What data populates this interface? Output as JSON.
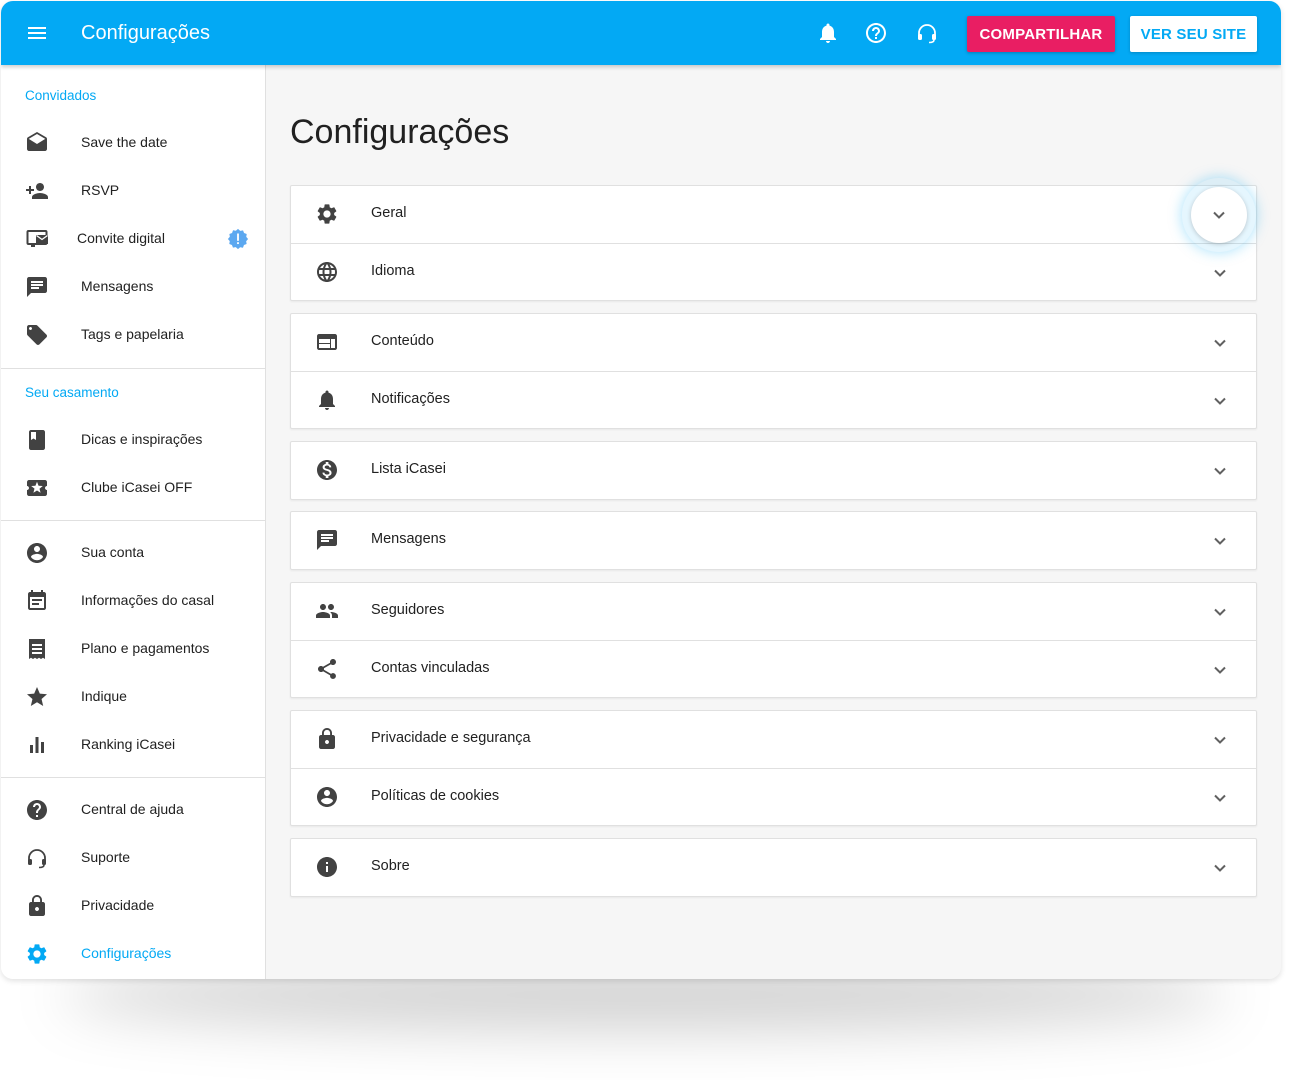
{
  "topbar": {
    "title": "Configurações",
    "share_label": "COMPARTILHAR",
    "site_label": "VER SEU SITE",
    "icons": [
      "menu-icon",
      "bell-icon",
      "help-circle-icon",
      "support-icon"
    ]
  },
  "sidebar": {
    "sections": [
      {
        "label": "Convidados",
        "items": [
          {
            "label": "Save the date",
            "icon": "drafts-icon"
          },
          {
            "label": "RSVP",
            "icon": "person-add-icon"
          },
          {
            "label": "Convite digital",
            "icon": "digital-invite-icon",
            "badge": "info-icon"
          },
          {
            "label": "Mensagens",
            "icon": "message-icon"
          },
          {
            "label": "Tags e papelaria",
            "icon": "tag-icon"
          }
        ]
      },
      {
        "label": "Seu casamento",
        "items": [
          {
            "label": "Dicas e inspirações",
            "icon": "book-icon"
          },
          {
            "label": "Clube iCasei OFF",
            "icon": "ticket-icon"
          }
        ]
      },
      {
        "label": "",
        "items": [
          {
            "label": "Sua conta",
            "icon": "account-circle-icon"
          },
          {
            "label": "Informações do casal",
            "icon": "event-note-icon"
          },
          {
            "label": "Plano e pagamentos",
            "icon": "receipt-icon"
          },
          {
            "label": "Indique",
            "icon": "star-icon"
          },
          {
            "label": "Ranking iCasei",
            "icon": "bar-chart-icon"
          }
        ]
      },
      {
        "label": "",
        "items": [
          {
            "label": "Central de ajuda",
            "icon": "help-icon"
          },
          {
            "label": "Suporte",
            "icon": "support-icon"
          },
          {
            "label": "Privacidade",
            "icon": "lock-icon"
          },
          {
            "label": "Configurações",
            "icon": "gear-icon",
            "active": true
          }
        ]
      }
    ]
  },
  "main": {
    "title": "Configurações",
    "groups": [
      [
        {
          "label": "Geral",
          "icon": "gear-icon"
        },
        {
          "label": "Idioma",
          "icon": "globe-icon"
        }
      ],
      [
        {
          "label": "Conteúdo",
          "icon": "web-icon"
        },
        {
          "label": "Notificações",
          "icon": "bell-icon"
        }
      ],
      [
        {
          "label": "Lista iCasei",
          "icon": "dollar-icon"
        }
      ],
      [
        {
          "label": "Mensagens",
          "icon": "message-icon"
        }
      ],
      [
        {
          "label": "Seguidores",
          "icon": "people-icon"
        },
        {
          "label": "Contas vinculadas",
          "icon": "share-icon"
        }
      ],
      [
        {
          "label": "Privacidade e segurança",
          "icon": "lock-icon"
        },
        {
          "label": "Políticas de cookies",
          "icon": "account-circle-icon"
        }
      ],
      [
        {
          "label": "Sobre",
          "icon": "info-icon"
        }
      ]
    ]
  },
  "colors": {
    "primary": "#03a9f4",
    "accent": "#e91e63",
    "icon": "#424242",
    "text": "#212121",
    "divider": "#e0e0e0"
  }
}
